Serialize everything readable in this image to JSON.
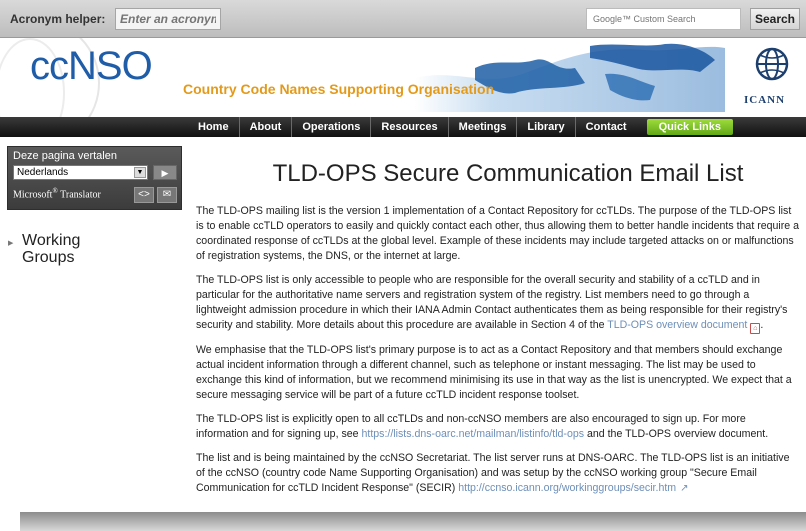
{
  "topbar": {
    "acronym_label": "Acronym helper:",
    "acronym_placeholder": "Enter an acronym",
    "search_placeholder": "Google™ Custom Search",
    "search_button": "Search"
  },
  "header": {
    "logo_text": "ccNSO",
    "tagline": "Country Code Names Supporting Organisation",
    "icann_text": "ICANN"
  },
  "nav": {
    "items": [
      "Home",
      "About",
      "Operations",
      "Resources",
      "Meetings",
      "Library",
      "Contact"
    ],
    "quick_links": "Quick Links"
  },
  "translator": {
    "title": "Deze pagina vertalen",
    "selected_language": "Nederlands",
    "brand": "Microsoft",
    "brand_suffix": "Translator"
  },
  "sidebar": {
    "working_groups": "Working Groups"
  },
  "main": {
    "title": "TLD-OPS Secure Communication Email List",
    "p1": "The TLD-OPS mailing list is the version 1 implementation of a Contact Repository for ccTLDs. The purpose of the TLD-OPS list is to enable ccTLD operators to easily and quickly contact each other, thus allowing them to better handle incidents that require a coordinated response of ccTLDs at the global level. Example of these incidents may include targeted attacks on or malfunctions of registration systems, the DNS, or the internet at large.",
    "p2_text": "The TLD-OPS list is only accessible to people who are responsible for the overall security and stability of a ccTLD and in particular for the authoritative name servers and registration system of the registry. List members need to go through a lightweight admission procedure in which their IANA Admin Contact authenticates them as being responsible for their registry's security and stability. More details about this procedure are available in Section 4 of the ",
    "p2_link": "TLD-OPS overview document",
    "p3": "We emphasise that the TLD-OPS list's primary purpose is to act as a Contact Repository and that members should exchange actual incident information through a different channel, such as telephone or instant messaging. The list may be used to exchange this kind of information, but we recommend minimising its use in that way as the list is unencrypted. We expect that a secure messaging service will be part of a future ccTLD incident response toolset.",
    "p4_text": "The TLD-OPS list is explicitly open to all ccTLDs and non-ccNSO members are also encouraged to sign up. For more information and for signing up, see ",
    "p4_link": "https://lists.dns-oarc.net/mailman/listinfo/tld-ops",
    "p4_tail": " and the TLD-OPS overview document.",
    "p5_text": "The list and is being maintained by the ccNSO Secretariat. The list server runs at DNS-OARC. The TLD-OPS list is an initiative of the ccNSO (country code Name Supporting Organisation) and was setup by the ccNSO working group \"Secure Email Communication for ccTLD Incident Response\" (SECIR) ",
    "p5_link": "http://ccnso.icann.org/workinggroups/secir.htm"
  },
  "colors": {
    "brand_blue": "#1f5da8",
    "tagline_orange": "#e39a1b",
    "quick_links_green": "#7cc22a",
    "link_blue": "#6d8fb8"
  }
}
